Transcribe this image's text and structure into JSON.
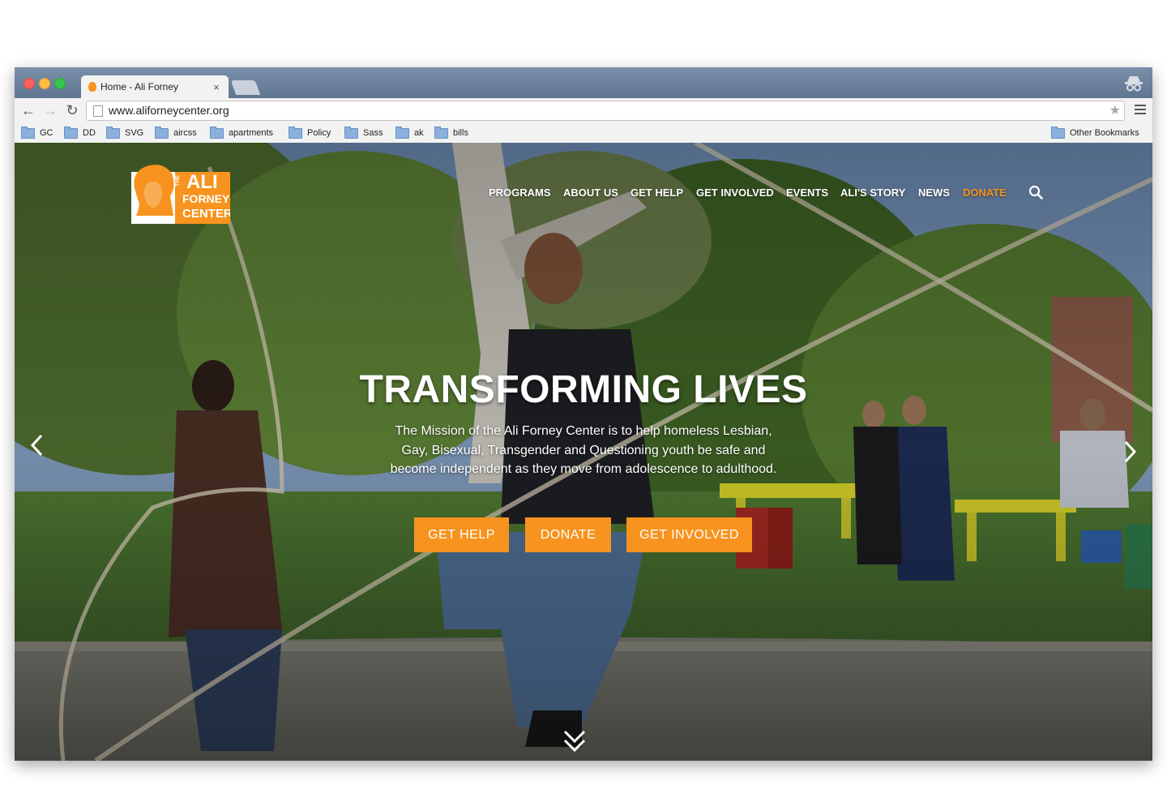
{
  "browser": {
    "tab_title": "Home - Ali Forney",
    "tab_close": "×",
    "url": "www.aliforneycenter.org",
    "bookmarks": [
      "GC",
      "DD",
      "SVG",
      "aircss",
      "apartments",
      "Policy",
      "Sass",
      "ak",
      "bills"
    ],
    "other_bookmarks": "Other Bookmarks"
  },
  "site": {
    "logo": {
      "line1": "THE",
      "line2": "ALI",
      "line3": "FORNEY",
      "line4": "CENTER"
    },
    "nav": {
      "programs": "PROGRAMS",
      "about": "ABOUT US",
      "get_help": "GET HELP",
      "get_involved": "GET INVOLVED",
      "events": "EVENTS",
      "alis_story": "ALI'S STORY",
      "news": "NEWS",
      "donate": "DONATE"
    },
    "hero": {
      "title": "TRANSFORMING LIVES",
      "text": "The Mission of the Ali Forney Center is to help homeless Lesbian, Gay, Bisexual, Transgender and Questioning youth be safe and become independent as they move from adolescence to adulthood.",
      "buttons": {
        "get_help": "GET HELP",
        "donate": "DONATE",
        "get_involved": "GET INVOLVED"
      }
    },
    "colors": {
      "accent": "#f7931e",
      "nav_text": "#ffffff"
    }
  }
}
